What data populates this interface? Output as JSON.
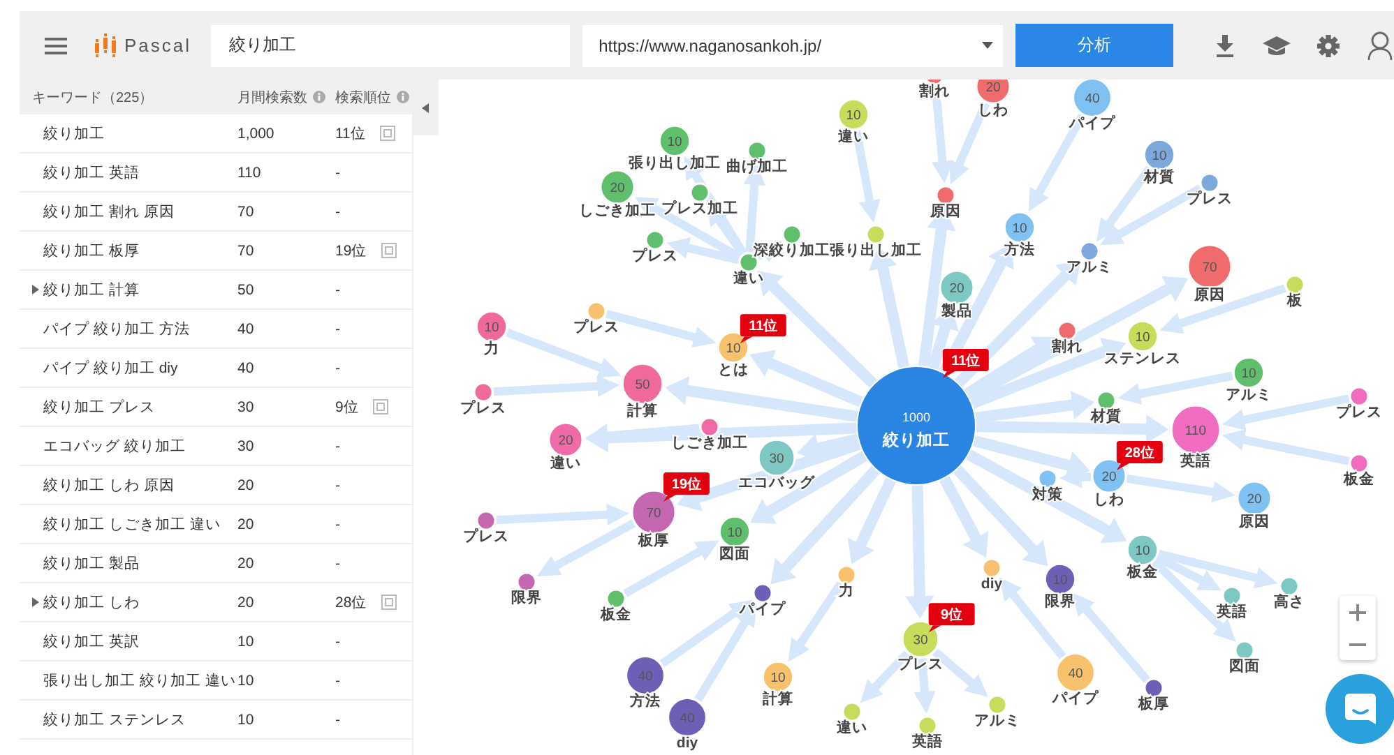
{
  "toolbar": {
    "app_name": "Pascal",
    "keyword": "絞り加工",
    "url": "https://www.naganosankoh.jp/",
    "analyze_button": "分析"
  },
  "keyword_table": {
    "columns": [
      "キーワード（225）",
      "月間検索数",
      "検索順位"
    ],
    "rows": [
      {
        "keyword": "絞り加工",
        "volume": "1,000",
        "rank": "11位",
        "expandable": false
      },
      {
        "keyword": "絞り加工 英語",
        "volume": "110",
        "rank": "-",
        "expandable": false
      },
      {
        "keyword": "絞り加工 割れ 原因",
        "volume": "70",
        "rank": "-",
        "expandable": false
      },
      {
        "keyword": "絞り加工 板厚",
        "volume": "70",
        "rank": "19位",
        "expandable": false
      },
      {
        "keyword": "絞り加工 計算",
        "volume": "50",
        "rank": "-",
        "expandable": true
      },
      {
        "keyword": "パイプ 絞り加工 方法",
        "volume": "40",
        "rank": "-",
        "expandable": false
      },
      {
        "keyword": "パイプ 絞り加工 diy",
        "volume": "40",
        "rank": "-",
        "expandable": false
      },
      {
        "keyword": "絞り加工 プレス",
        "volume": "30",
        "rank": "9位",
        "expandable": false
      },
      {
        "keyword": "エコバッグ 絞り加工",
        "volume": "30",
        "rank": "-",
        "expandable": false
      },
      {
        "keyword": "絞り加工 しわ 原因",
        "volume": "20",
        "rank": "-",
        "expandable": false
      },
      {
        "keyword": "絞り加工 しごき加工 違い",
        "volume": "20",
        "rank": "-",
        "expandable": false
      },
      {
        "keyword": "絞り加工 製品",
        "volume": "20",
        "rank": "-",
        "expandable": false
      },
      {
        "keyword": "絞り加工 しわ",
        "volume": "20",
        "rank": "28位",
        "expandable": true
      },
      {
        "keyword": "絞り加工 英訳",
        "volume": "10",
        "rank": "-",
        "expandable": false
      },
      {
        "keyword": "張り出し加工 絞り加工 違い",
        "volume": "10",
        "rank": "-",
        "expandable": false
      },
      {
        "keyword": "絞り加工 ステンレス",
        "volume": "10",
        "rank": "-",
        "expandable": false
      }
    ]
  },
  "graph": {
    "root": {
      "kind": "root",
      "label": "絞り加工",
      "count": "1000",
      "color": "#2a84e2",
      "rank": "11位",
      "children": [
        {
          "kind": "keyword",
          "label": "違い",
          "color": "#5fbf6c",
          "to_parent": false,
          "children": [
            {
              "kind": "keyword",
              "label": "張り出し加工",
              "count": "10",
              "color": "#5fbf6c",
              "to_parent": false
            },
            {
              "kind": "keyword",
              "label": "曲げ加工",
              "color": "#5fbf6c",
              "to_parent": false
            },
            {
              "kind": "keyword",
              "label": "しごき加工",
              "count": "20",
              "color": "#5fbf6c",
              "to_parent": false
            },
            {
              "kind": "keyword",
              "label": "プレス加工",
              "color": "#5fbf6c",
              "to_parent": false
            },
            {
              "kind": "keyword",
              "label": "プレス",
              "color": "#5fbf6c",
              "to_parent": false
            },
            {
              "kind": "keyword",
              "label": "深絞り加工",
              "color": "#5fbf6c",
              "to_parent": false
            }
          ]
        },
        {
          "kind": "keyword",
          "label": "張り出し加工",
          "color": "#c8dc5c",
          "to_parent": false,
          "children": [
            {
              "kind": "keyword",
              "label": "違い",
              "count": "10",
              "color": "#c8dc5c",
              "to_parent": true
            }
          ]
        },
        {
          "kind": "keyword",
          "label": "原因",
          "color": "#f06b6b",
          "to_parent": false,
          "children": [
            {
              "kind": "keyword",
              "label": "割れ",
              "color": "#f06b6b",
              "to_parent": true
            },
            {
              "kind": "keyword",
              "label": "しわ",
              "count": "20",
              "color": "#f06b6b",
              "to_parent": true
            }
          ]
        },
        {
          "kind": "keyword",
          "label": "方法",
          "count": "10",
          "color": "#7fc1f3",
          "to_parent": false,
          "children": [
            {
              "kind": "keyword",
              "label": "パイプ",
              "count": "40",
              "color": "#7fc1f3",
              "to_parent": true
            }
          ]
        },
        {
          "kind": "keyword",
          "label": "製品",
          "count": "20",
          "color": "#7ec8c3",
          "to_parent": false
        },
        {
          "kind": "keyword",
          "label": "アルミ",
          "color": "#7ca8dc",
          "to_parent": false,
          "children": [
            {
              "kind": "keyword",
              "label": "材質",
              "count": "10",
              "color": "#7ca8dc",
              "to_parent": true
            },
            {
              "kind": "keyword",
              "label": "プレス",
              "color": "#7ca8dc",
              "to_parent": true
            }
          ]
        },
        {
          "kind": "keyword",
          "label": "原因",
          "count": "70",
          "color": "#f06b6b",
          "to_parent": false
        },
        {
          "kind": "keyword",
          "label": "計算",
          "count": "50",
          "color": "#ef6a9a",
          "to_parent": false,
          "children": [
            {
              "kind": "keyword",
              "label": "力",
              "count": "10",
              "color": "#ef6a9a",
              "to_parent": true
            },
            {
              "kind": "keyword",
              "label": "プレス",
              "color": "#ef6a9a",
              "to_parent": true
            }
          ]
        },
        {
          "kind": "keyword",
          "label": "とは",
          "count": "10",
          "color": "#f8c16e",
          "rank": "11位",
          "to_parent": false,
          "children": [
            {
              "kind": "keyword",
              "label": "プレス",
              "color": "#f8c16e",
              "to_parent": true
            }
          ]
        },
        {
          "kind": "keyword",
          "label": "割れ",
          "color": "#f06b6b",
          "to_parent": false
        },
        {
          "kind": "keyword",
          "label": "ステンレス",
          "count": "10",
          "color": "#c8dc5c",
          "to_parent": false,
          "children": [
            {
              "kind": "keyword",
              "label": "板",
              "color": "#c8dc5c",
              "to_parent": true
            }
          ]
        },
        {
          "kind": "keyword",
          "label": "違い",
          "count": "20",
          "color": "#f06aa8",
          "to_parent": false,
          "children": [
            {
              "kind": "keyword",
              "label": "しごき加工",
              "color": "#f06aa8",
              "to_parent": true
            }
          ]
        },
        {
          "kind": "keyword",
          "label": "エコバッグ",
          "count": "30",
          "color": "#7ec8c3",
          "to_parent": false
        },
        {
          "kind": "keyword",
          "label": "板厚",
          "count": "70",
          "color": "#c566b0",
          "rank": "19位",
          "to_parent": false,
          "children": [
            {
              "kind": "keyword",
              "label": "プレス",
              "color": "#c566b0",
              "to_parent": true
            },
            {
              "kind": "keyword",
              "label": "限界",
              "color": "#c566b0",
              "to_parent": false
            }
          ]
        },
        {
          "kind": "keyword",
          "label": "図面",
          "count": "10",
          "color": "#5fbf6c",
          "to_parent": false,
          "children": [
            {
              "kind": "keyword",
              "label": "板金",
              "color": "#5fbf6c",
              "to_parent": true
            }
          ]
        },
        {
          "kind": "keyword",
          "label": "材質",
          "color": "#5fbf6c",
          "to_parent": false,
          "children": [
            {
              "kind": "keyword",
              "label": "アルミ",
              "count": "10",
              "color": "#5fbf6c",
              "to_parent": true
            }
          ]
        },
        {
          "kind": "keyword",
          "label": "しわ",
          "count": "20",
          "color": "#7fc1f3",
          "rank": "28位",
          "to_parent": false,
          "children": [
            {
              "kind": "keyword",
              "label": "対策",
              "color": "#7fc1f3",
              "to_parent": false
            },
            {
              "kind": "keyword",
              "label": "原因",
              "count": "20",
              "color": "#7fc1f3",
              "to_parent": false
            }
          ]
        },
        {
          "kind": "keyword",
          "label": "英語",
          "count": "110",
          "color": "#ef6cc0",
          "to_parent": false,
          "children": [
            {
              "kind": "keyword",
              "label": "プレス",
              "color": "#ef6cc0",
              "to_parent": true
            },
            {
              "kind": "keyword",
              "label": "板金",
              "color": "#ef6cc0",
              "to_parent": true
            }
          ]
        },
        {
          "kind": "keyword",
          "label": "パイプ",
          "color": "#6d5fb6",
          "to_parent": false,
          "children": [
            {
              "kind": "keyword",
              "label": "方法",
              "count": "40",
              "color": "#6d5fb6",
              "to_parent": true
            },
            {
              "kind": "keyword",
              "label": "diy",
              "count": "40",
              "color": "#6d5fb6",
              "to_parent": true
            }
          ]
        },
        {
          "kind": "keyword",
          "label": "力",
          "color": "#f8c16e",
          "to_parent": false,
          "children": [
            {
              "kind": "keyword",
              "label": "計算",
              "count": "10",
              "color": "#f8c16e",
              "to_parent": false
            }
          ]
        },
        {
          "kind": "keyword",
          "label": "プレス",
          "count": "30",
          "color": "#c8dc5c",
          "rank": "9位",
          "to_parent": false,
          "children": [
            {
              "kind": "keyword",
              "label": "違い",
              "color": "#c8dc5c",
              "to_parent": false
            },
            {
              "kind": "keyword",
              "label": "英語",
              "color": "#c8dc5c",
              "to_parent": false
            },
            {
              "kind": "keyword",
              "label": "アルミ",
              "color": "#c8dc5c",
              "to_parent": false
            }
          ]
        },
        {
          "kind": "keyword",
          "label": "diy",
          "color": "#f8c16e",
          "to_parent": false,
          "children": [
            {
              "kind": "keyword",
              "label": "パイプ",
              "count": "40",
              "color": "#f8c16e",
              "to_parent": true
            }
          ]
        },
        {
          "kind": "keyword",
          "label": "限界",
          "count": "10",
          "color": "#6d5fb6",
          "to_parent": false,
          "children": [
            {
              "kind": "keyword",
              "label": "板厚",
              "color": "#6d5fb6",
              "to_parent": true
            }
          ]
        },
        {
          "kind": "keyword",
          "label": "板金",
          "count": "10",
          "color": "#7ec8c3",
          "to_parent": false,
          "children": [
            {
              "kind": "keyword",
              "label": "英語",
              "color": "#7ec8c3",
              "to_parent": false
            },
            {
              "kind": "keyword",
              "label": "高さ",
              "color": "#7ec8c3",
              "to_parent": false
            },
            {
              "kind": "keyword",
              "label": "図面",
              "color": "#7ec8c3",
              "to_parent": false
            }
          ]
        }
      ]
    }
  }
}
